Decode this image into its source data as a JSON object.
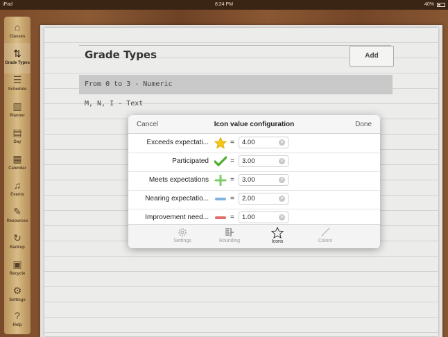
{
  "status_bar": {
    "device": "iPad",
    "time": "8:24 PM",
    "battery": "40%",
    "battery_level": 0.4
  },
  "sidebar": {
    "items": [
      {
        "label": "Classes"
      },
      {
        "label": "Grade Types"
      },
      {
        "label": "Schedule"
      },
      {
        "label": "Planner"
      },
      {
        "label": "Day"
      },
      {
        "label": "Calendar"
      },
      {
        "label": "Events"
      },
      {
        "label": "Resources"
      },
      {
        "label": "Backup"
      },
      {
        "label": "Recycle"
      },
      {
        "label": "Settings"
      },
      {
        "label": "Help"
      }
    ]
  },
  "page": {
    "title": "Grade Types",
    "add_label": "Add",
    "grade_types": [
      {
        "label": "From 0 to 3 - Numeric"
      },
      {
        "label": "M, N, I - Text"
      }
    ]
  },
  "modal": {
    "cancel_label": "Cancel",
    "title": "Icon value configuration",
    "done_label": "Done",
    "rows": [
      {
        "name": "Exceeds expectati...",
        "icon": "star-icon",
        "value": "4.00"
      },
      {
        "name": "Participated",
        "icon": "checkmark-icon",
        "value": "3.00"
      },
      {
        "name": "Meets expectations",
        "icon": "plus-icon",
        "value": "3.00"
      },
      {
        "name": "Nearing expectatio...",
        "icon": "blue-dash-icon",
        "value": "2.00"
      },
      {
        "name": "Improvement need...",
        "icon": "red-dash-icon",
        "value": "1.00"
      }
    ],
    "tabs": [
      {
        "label": "Settings",
        "icon": "gear-icon"
      },
      {
        "label": "Rounding",
        "icon": "rounding-icon"
      },
      {
        "label": "Icons",
        "icon": "star-outline-icon"
      },
      {
        "label": "Colors",
        "icon": "brush-icon"
      }
    ]
  },
  "colors": {
    "star": "#f5c518",
    "check": "#4caf2a",
    "plus": "#7ecb6a",
    "blue_dash": "#7fb3e0",
    "red_dash": "#e06c6c"
  }
}
